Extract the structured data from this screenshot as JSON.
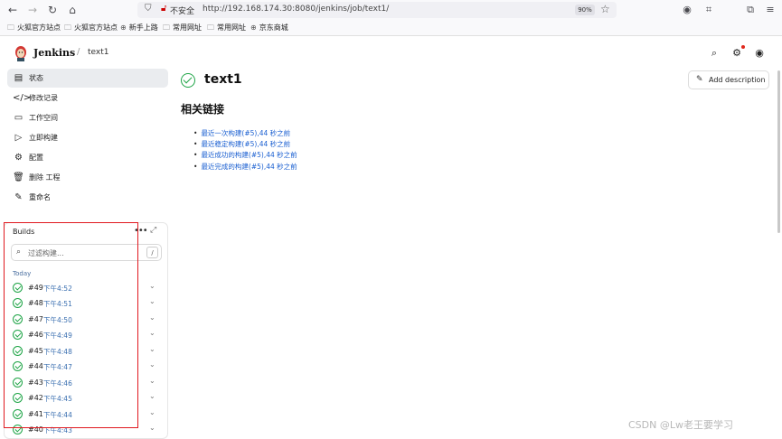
{
  "browser": {
    "url": "http://192.168.174.30:8080/jenkins/job/text1/",
    "security_text": "不安全",
    "zoom": "90%",
    "bookmarks": [
      "火狐官方站点",
      "火狐官方站点",
      "新手上路",
      "常用网址",
      "常用网址",
      "京东商城"
    ]
  },
  "header": {
    "brand": "Jenkins",
    "breadcrumb_job": "text1"
  },
  "sidebar": {
    "items": [
      {
        "label": "状态",
        "icon": "document-icon"
      },
      {
        "label": "修改记录",
        "icon": "code-icon"
      },
      {
        "label": "工作空间",
        "icon": "folder-icon"
      },
      {
        "label": "立即构建",
        "icon": "play-icon"
      },
      {
        "label": "配置",
        "icon": "gear-icon"
      },
      {
        "label": "删除 工程",
        "icon": "trash-icon"
      },
      {
        "label": "重命名",
        "icon": "pencil-icon"
      }
    ]
  },
  "builds": {
    "title": "Builds",
    "filter_placeholder": "过滤构建...",
    "shortcut": "/",
    "group_label": "Today",
    "items": [
      {
        "number": "#49",
        "time": "下午4:52"
      },
      {
        "number": "#48",
        "time": "下午4:51"
      },
      {
        "number": "#47",
        "time": "下午4:50"
      },
      {
        "number": "#46",
        "time": "下午4:49"
      },
      {
        "number": "#45",
        "time": "下午4:48"
      },
      {
        "number": "#44",
        "time": "下午4:47"
      },
      {
        "number": "#43",
        "time": "下午4:46"
      },
      {
        "number": "#42",
        "time": "下午4:45"
      },
      {
        "number": "#41",
        "time": "下午4:44"
      },
      {
        "number": "#40",
        "time": "下午4:43"
      }
    ]
  },
  "main": {
    "job_title": "text1",
    "add_description": "Add description",
    "related_heading": "相关链接",
    "related_links": [
      "最近一次构建(#5),44 秒之前",
      "最近稳定构建(#5),44 秒之前",
      "最近成功的构建(#5),44 秒之前",
      "最近完成的构建(#5),44 秒之前"
    ]
  },
  "watermark": "CSDN @Lw老王要学习",
  "colors": {
    "success": "#1ea446",
    "link": "#1a5fd1",
    "highlight": "#e0191f"
  }
}
